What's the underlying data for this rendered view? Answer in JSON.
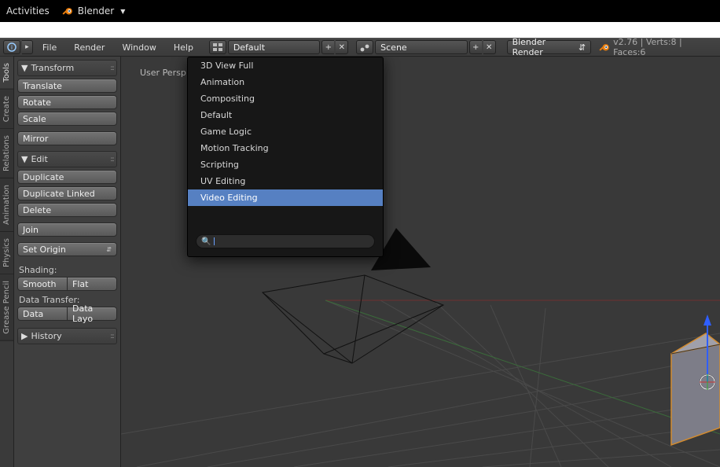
{
  "os": {
    "activities": "Activities",
    "app_name": "Blender"
  },
  "header": {
    "menus": {
      "file": "File",
      "render": "Render",
      "window": "Window",
      "help": "Help"
    },
    "layout_field": "Default",
    "scene_field": "Scene",
    "engine_field": "Blender Render",
    "status": "v2.76 | Verts:8 | Faces:6"
  },
  "vtabs": [
    "Tools",
    "Create",
    "Relations",
    "Animation",
    "Physics",
    "Grease Pencil"
  ],
  "toolshelf": {
    "transform": {
      "title": "Transform",
      "translate": "Translate",
      "rotate": "Rotate",
      "scale": "Scale",
      "mirror": "Mirror"
    },
    "edit": {
      "title": "Edit",
      "duplicate": "Duplicate",
      "duplicate_linked": "Duplicate Linked",
      "delete": "Delete",
      "join": "Join",
      "set_origin": "Set Origin"
    },
    "shading": {
      "label": "Shading:",
      "smooth": "Smooth",
      "flat": "Flat"
    },
    "data_transfer": {
      "label": "Data Transfer:",
      "data": "Data",
      "data_layo": "Data Layo"
    },
    "history": {
      "title": "History"
    }
  },
  "viewport": {
    "persp": "User Persp"
  },
  "popup": {
    "items": [
      "3D View Full",
      "Animation",
      "Compositing",
      "Default",
      "Game Logic",
      "Motion Tracking",
      "Scripting",
      "UV Editing",
      "Video Editing"
    ],
    "hover_index": 8,
    "search_value": ""
  }
}
